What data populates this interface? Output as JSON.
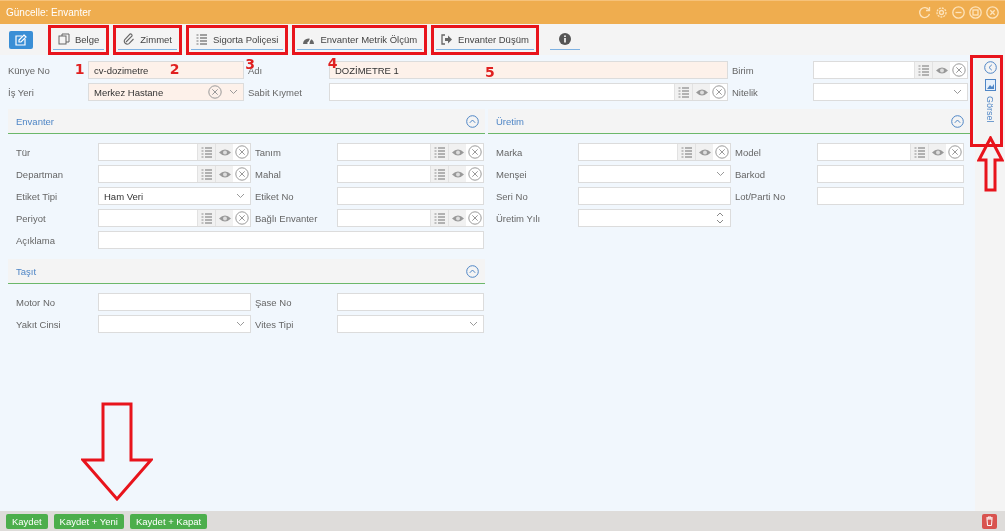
{
  "window": {
    "title": "Güncelle: Envanter"
  },
  "toolbar": {
    "tabs": [
      {
        "label": "Belge",
        "highlighted": true,
        "marker": "1"
      },
      {
        "label": "Zimmet",
        "highlighted": true,
        "marker": "2"
      },
      {
        "label": "Sigorta Poliçesi",
        "highlighted": true,
        "marker": "3"
      },
      {
        "label": "Envanter Metrik Ölçüm",
        "highlighted": true,
        "marker": "4"
      },
      {
        "label": "Envanter Düşüm",
        "highlighted": true,
        "marker": "5"
      }
    ]
  },
  "header_fields": [
    {
      "label": "Künye No",
      "kind": "text",
      "value": "cv-dozimetre",
      "required": true
    },
    {
      "label": "Adı",
      "kind": "text",
      "value": "DOZİMETRE 1",
      "required": true
    },
    {
      "label": "Birim",
      "kind": "lookup",
      "required": false
    },
    {
      "label": "İş Yeri",
      "kind": "select-clear",
      "value": "Merkez Hastane",
      "required": true
    },
    {
      "label": "Sabit Kıymet",
      "kind": "lookup",
      "required": false
    },
    {
      "label": "Nitelik",
      "kind": "select",
      "required": false
    }
  ],
  "panels": [
    {
      "title": "Envanter",
      "expanded": true,
      "fields": [
        {
          "label": "Tür",
          "kind": "lookup"
        },
        {
          "label": "Tanım",
          "kind": "lookup"
        },
        {
          "label": "Departman",
          "kind": "lookup"
        },
        {
          "label": "Mahal",
          "kind": "lookup"
        },
        {
          "label": "Etiket Tipi",
          "kind": "select",
          "value": "Ham Veri"
        },
        {
          "label": "Etiket No",
          "kind": "text"
        },
        {
          "label": "Periyot",
          "kind": "lookup"
        },
        {
          "label": "Bağlı Envanter",
          "kind": "lookup"
        },
        {
          "label": "Açıklama",
          "kind": "wide"
        }
      ]
    },
    {
      "title": "Üretim",
      "expanded": true,
      "fields": [
        {
          "label": "Marka",
          "kind": "lookup"
        },
        {
          "label": "Model",
          "kind": "lookup"
        },
        {
          "label": "Menşei",
          "kind": "select"
        },
        {
          "label": "Barkod",
          "kind": "text"
        },
        {
          "label": "Seri No",
          "kind": "text"
        },
        {
          "label": "Lot/Parti No",
          "kind": "text"
        },
        {
          "label": "Üretim Yılı",
          "kind": "number"
        }
      ]
    },
    {
      "title": "Taşıt",
      "expanded": true,
      "fields": [
        {
          "label": "Motor No",
          "kind": "text"
        },
        {
          "label": "Şase No",
          "kind": "text"
        },
        {
          "label": "Yakıt Cinsi",
          "kind": "select"
        },
        {
          "label": "Vites Tipi",
          "kind": "select"
        }
      ]
    }
  ],
  "side_rail": {
    "label": "Görsel",
    "highlighted": true
  },
  "footer": {
    "buttons": [
      "Kaydet",
      "Kaydet + Yeni",
      "Kaydet + Kapat"
    ]
  },
  "annotations": [
    {
      "kind": "down-arrow"
    },
    {
      "kind": "up-arrow"
    }
  ]
}
